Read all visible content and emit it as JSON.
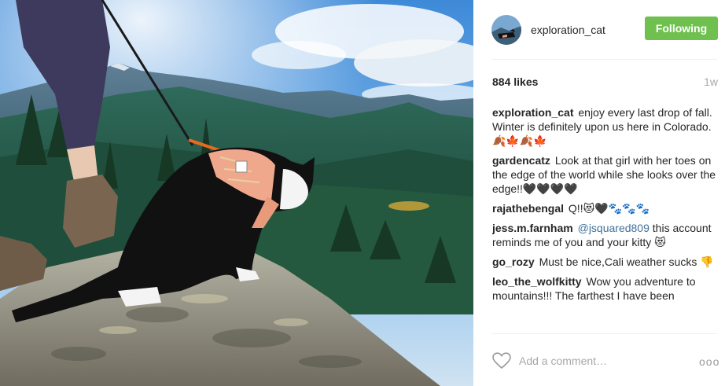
{
  "post": {
    "author": "exploration_cat",
    "follow_label": "Following",
    "likes": "884 likes",
    "time": "1w"
  },
  "comments": [
    {
      "user": "exploration_cat",
      "text": "enjoy every last drop of fall. Winter is definitely upon us here in Colorado.🍂🍁🍂🍁"
    },
    {
      "user": "gardencatz",
      "text": "Look at that girl with her toes on the edge of the world while she looks over the edge!!🖤🖤🖤🖤"
    },
    {
      "user": "rajathebengal",
      "text": "Q!!😻🖤🐾🐾🐾"
    },
    {
      "user": "jess.m.farnham",
      "mention": "@jsquared809",
      "text": "this account reminds me of you and your kitty 😻"
    },
    {
      "user": "go_rozy",
      "text": "Must be nice,Cali weather sucks 👎"
    },
    {
      "user": "leo_the_wolfkitty",
      "text": "Wow you adventure to mountains!!! The farthest I have been"
    }
  ],
  "footer": {
    "placeholder": "Add a comment…",
    "more": "ooo"
  },
  "colors": {
    "follow_bg": "#70c050",
    "mention": "#3f729b",
    "muted": "#a5a7aa"
  }
}
